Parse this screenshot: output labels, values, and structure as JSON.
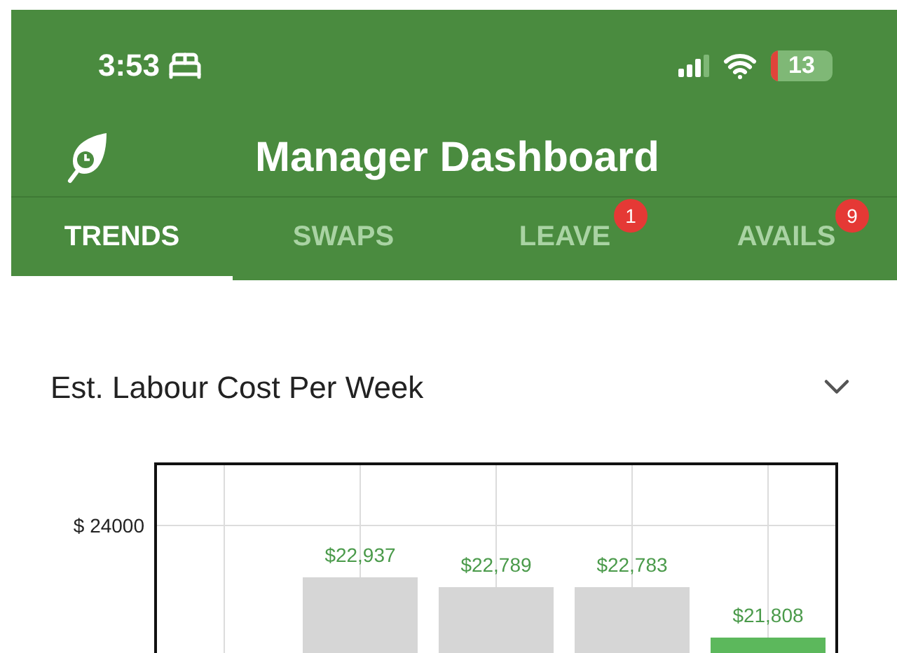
{
  "status_bar": {
    "time": "3:53",
    "battery": "13"
  },
  "header": {
    "title": "Manager Dashboard"
  },
  "tabs": [
    {
      "label": "TRENDS",
      "selected": true
    },
    {
      "label": "SWAPS",
      "selected": false
    },
    {
      "label": "LEAVE",
      "selected": false,
      "badge": "1"
    },
    {
      "label": "AVAILS",
      "selected": false,
      "badge": "9"
    }
  ],
  "card": {
    "title": "Est. Labour Cost Per Week",
    "expanded": false,
    "chart": {
      "axis_label": "$ 24000",
      "bars": [
        {
          "label": "$22,937",
          "current": false
        },
        {
          "label": "$22,789",
          "current": false
        },
        {
          "label": "$22,783",
          "current": false
        },
        {
          "label": "$21,808",
          "current": true
        }
      ]
    }
  }
}
